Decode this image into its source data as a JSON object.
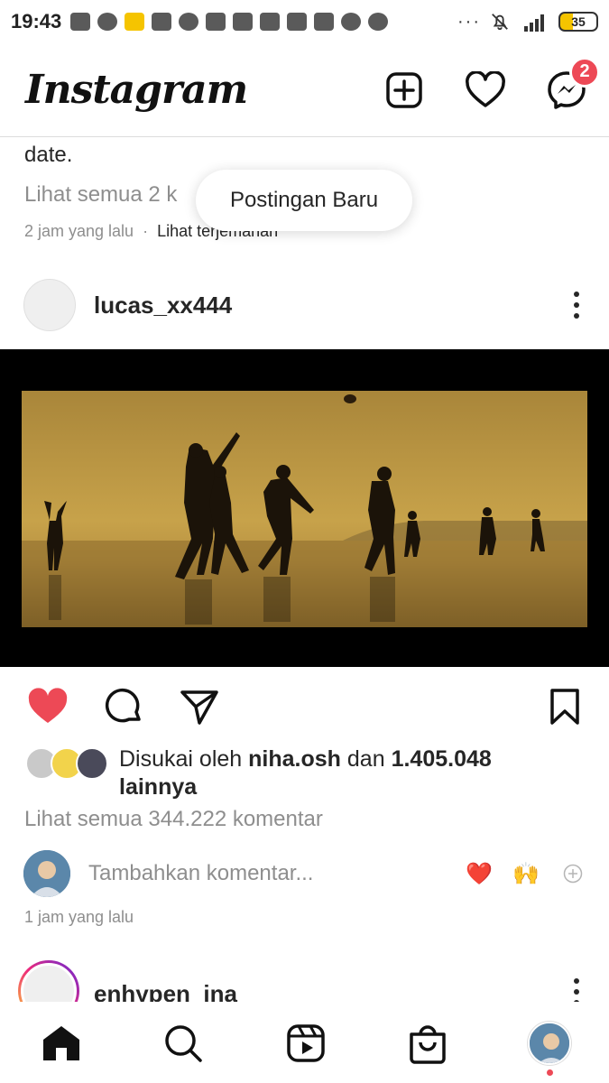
{
  "status_bar": {
    "time": "19:43",
    "battery": "35",
    "overflow": "···"
  },
  "header": {
    "logo": "Instagram",
    "messenger_badge": "2",
    "icons": [
      "new-post-icon",
      "heart-icon",
      "messenger-icon"
    ]
  },
  "previous_post": {
    "caption_tail": "date.",
    "view_comments": "Lihat semua 2 k",
    "time_ago": "2 jam yang lalu",
    "separator": "·",
    "translate": "Lihat terjemahan"
  },
  "toast": {
    "label": "Postingan Baru"
  },
  "post": {
    "username": "lucas_xx444",
    "liked_by_prefix": "Disukai oleh",
    "liked_by_user": "niha.osh",
    "liked_by_and": "dan",
    "liked_by_count": "1.405.048",
    "liked_by_suffix": "lainnya",
    "view_comments": "Lihat semua 344.222 komentar",
    "comment_placeholder": "Tambahkan komentar...",
    "quick_emojis": [
      "❤️",
      "🙌"
    ],
    "time_ago": "1 jam yang lalu",
    "liked": true
  },
  "next_post": {
    "username": "enhypen_ina"
  },
  "bottom_nav": {
    "items": [
      "home-icon",
      "search-icon",
      "reels-icon",
      "shop-icon",
      "profile-avatar"
    ]
  },
  "colors": {
    "like_red": "#ed4956",
    "text": "#262626",
    "secondary": "#8e8e8e"
  }
}
